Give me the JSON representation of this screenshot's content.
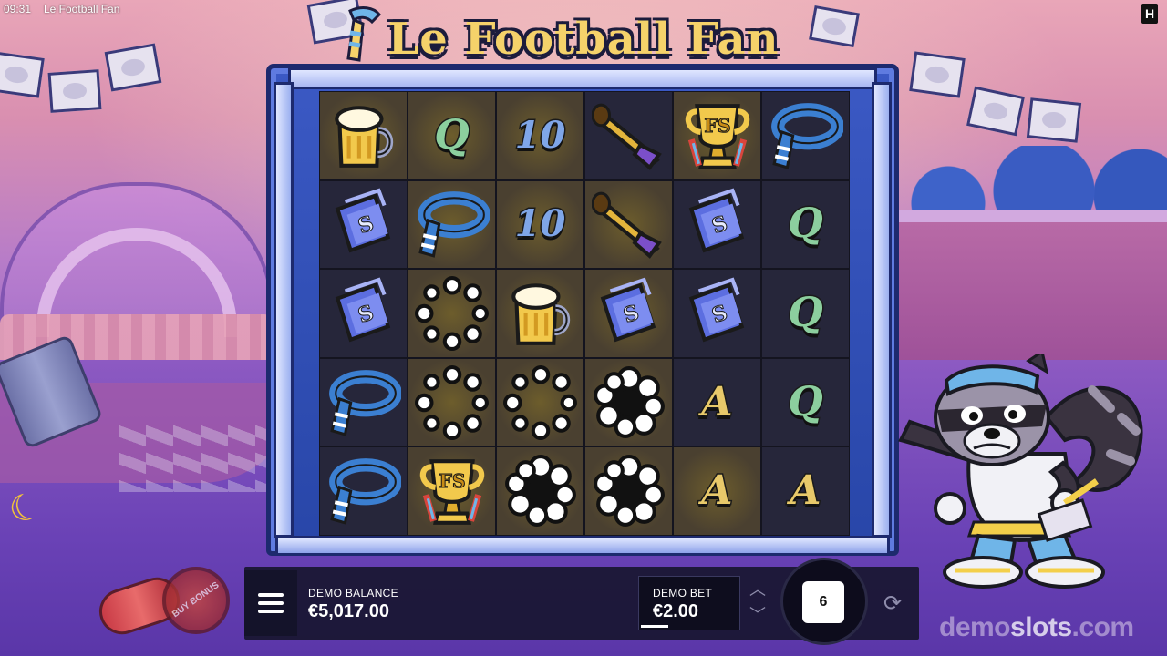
{
  "status_bar": {
    "time": "09:31",
    "window_title": "Le Football Fan"
  },
  "brand_logo": "H",
  "game": {
    "title": "Le Football Fan",
    "grid": [
      [
        "beer",
        "q",
        "ten",
        "horn",
        "trophy",
        "scarf"
      ],
      [
        "ticket",
        "scarf",
        "ten",
        "horn",
        "ticket",
        "q"
      ],
      [
        "ticket",
        "cloud",
        "beer",
        "ticket",
        "ticket",
        "q"
      ],
      [
        "scarf",
        "cloud",
        "cloud",
        "cloud_filled",
        "a",
        "q"
      ],
      [
        "scarf",
        "trophy",
        "cloud_filled",
        "cloud_filled",
        "a",
        "a"
      ]
    ],
    "highlighted": [
      [
        true,
        true,
        true,
        false,
        true,
        false
      ],
      [
        false,
        true,
        true,
        true,
        false,
        false
      ],
      [
        false,
        true,
        true,
        true,
        false,
        false
      ],
      [
        false,
        true,
        true,
        true,
        false,
        false
      ],
      [
        false,
        true,
        true,
        true,
        true,
        false
      ]
    ],
    "symbol_labels": {
      "q": "Q",
      "ten": "10",
      "a": "A",
      "trophy": "FS"
    }
  },
  "controls": {
    "balance_label": "DEMO BALANCE",
    "balance_value": "€5,017.00",
    "bet_label": "DEMO BET",
    "bet_value": "€2.00",
    "spin_count": "6",
    "buy_bonus_label": "BUY BONUS"
  },
  "watermark": {
    "part1": "demo",
    "part2": "slots",
    "part3": ".com"
  },
  "colors": {
    "frame_blue": "#2846a8",
    "title_gold": "#f5d26a",
    "control_bar": "#181630"
  }
}
